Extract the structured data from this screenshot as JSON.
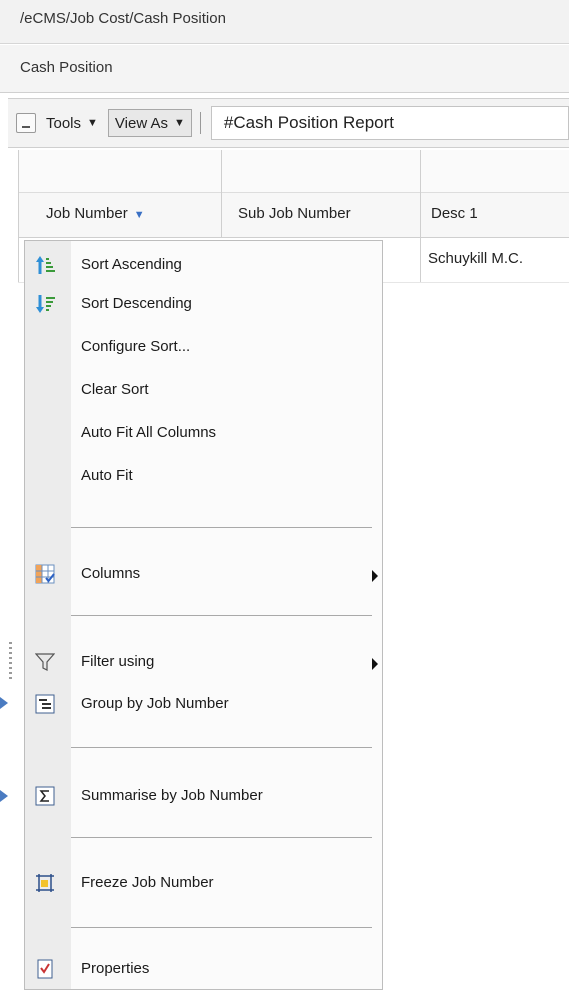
{
  "breadcrumb": "/eCMS/Job Cost/Cash Position",
  "page_title": "Cash Position",
  "toolbar": {
    "tools_label": "Tools",
    "view_as_label": "View As",
    "report_name": "#Cash Position Report"
  },
  "grid": {
    "columns": [
      "Job Number",
      "Sub Job Number",
      "Desc 1"
    ],
    "rows": [
      {
        "desc1": "Schuykill M.C."
      }
    ]
  },
  "context_menu": {
    "items": [
      {
        "label": "Sort Ascending",
        "icon": "sort-ascending-icon"
      },
      {
        "label": "Sort Descending",
        "icon": "sort-descending-icon"
      },
      {
        "label": "Configure Sort..."
      },
      {
        "label": "Clear Sort"
      },
      {
        "label": "Auto Fit All Columns"
      },
      {
        "label": "Auto Fit"
      },
      {
        "label": "Columns",
        "icon": "columns-icon",
        "submenu": true
      },
      {
        "label": "Filter using",
        "icon": "filter-icon",
        "submenu": true
      },
      {
        "label": "Group by Job Number",
        "icon": "group-icon"
      },
      {
        "label": "Summarise by Job Number",
        "icon": "sigma-icon"
      },
      {
        "label": "Freeze Job Number",
        "icon": "freeze-icon"
      },
      {
        "label": "Properties",
        "icon": "properties-icon"
      }
    ]
  },
  "colors": {
    "accent_blue": "#3a70c4",
    "pointer_arrow": "#4a7bc1"
  }
}
